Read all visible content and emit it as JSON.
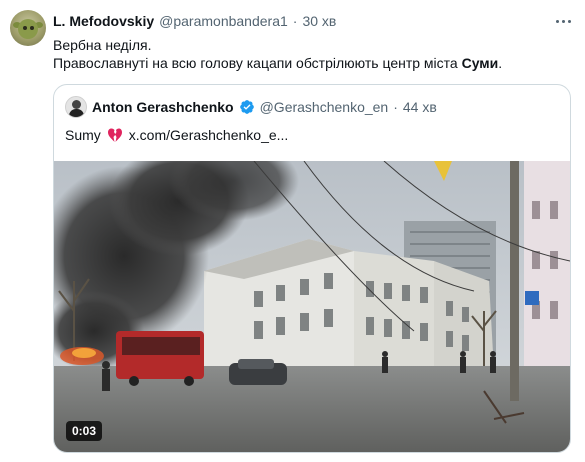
{
  "tweet": {
    "display_name": "L. Mefodovskiy",
    "handle": "@paramonbandera1",
    "separator": "·",
    "time": "30 хв",
    "line1": "Вербна неділя.",
    "line2_prefix": "Православнуті на всю голову кацапи обстрілюють центр міста ",
    "line2_city": "Суми",
    "line2_suffix": "."
  },
  "quote": {
    "display_name": "Anton Gerashchenko",
    "handle": "@Gerashchenko_en",
    "separator": "·",
    "time": "44 хв",
    "text": "Sumy",
    "link": "x.com/Gerashchenko_e...",
    "video_duration": "0:03"
  },
  "icons": {
    "more": "more-horizontal-icon",
    "verified": "verified-badge-icon",
    "heart": "broken-heart-emoji"
  },
  "colors": {
    "verified_blue": "#1d9bf0",
    "heart_red": "#e0245e",
    "muted": "#536471",
    "border": "#cfd9de"
  }
}
